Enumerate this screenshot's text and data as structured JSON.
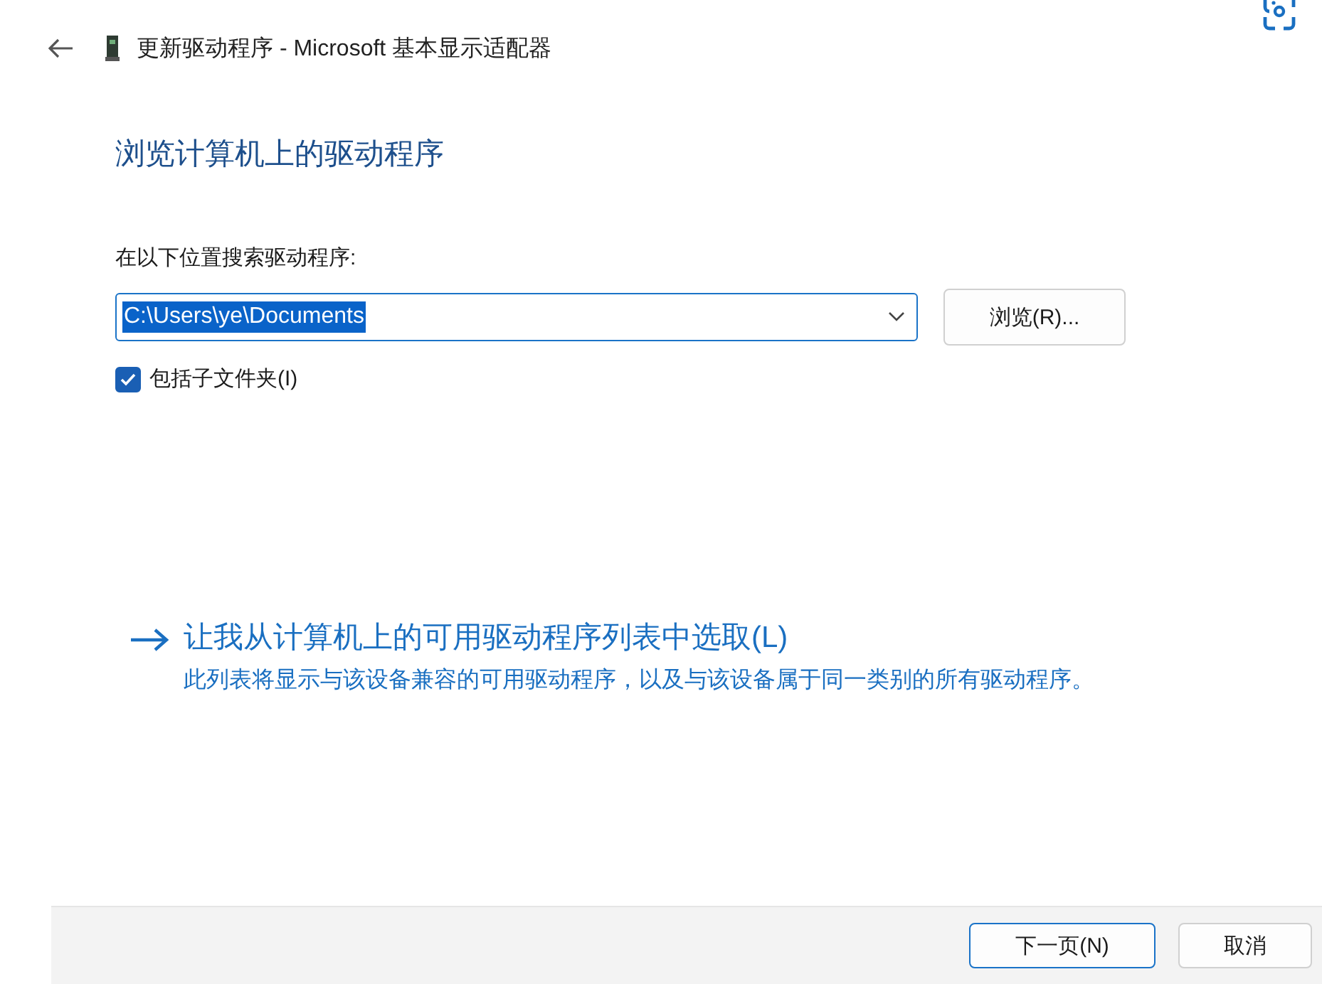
{
  "window": {
    "title": "更新驱动程序 - Microsoft 基本显示适配器"
  },
  "heading": "浏览计算机上的驱动程序",
  "search": {
    "label": "在以下位置搜索驱动程序:",
    "value": "C:\\Users\\ye\\Documents",
    "browse_button": "浏览(R)..."
  },
  "include_subfolders": {
    "label": "包括子文件夹(I)",
    "checked": true
  },
  "pick_option": {
    "title": "让我从计算机上的可用驱动程序列表中选取(L)",
    "description": "此列表将显示与该设备兼容的可用驱动程序，以及与该设备属于同一类别的所有驱动程序。"
  },
  "buttons": [
    {
      "label": "下一页(N)",
      "kind": "default"
    },
    {
      "label": "取消",
      "kind": "normal"
    }
  ]
}
